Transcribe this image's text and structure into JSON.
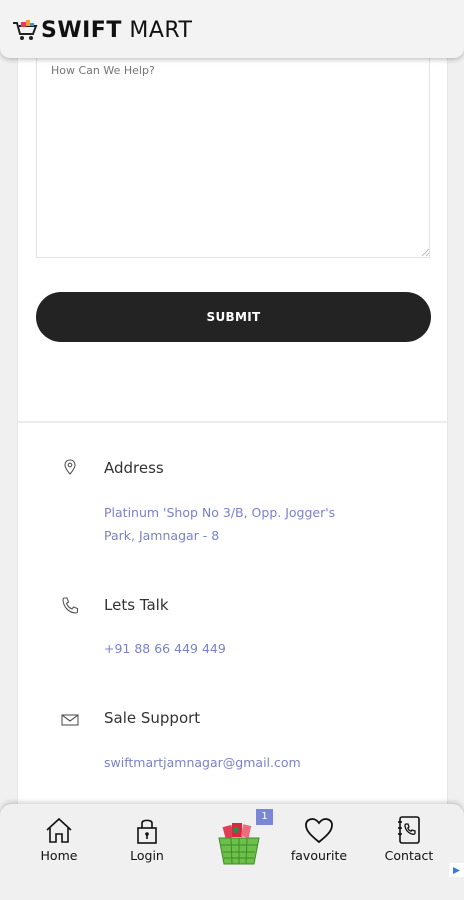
{
  "header": {
    "logo_bold": "SWIFT",
    "logo_regular": "MART"
  },
  "form": {
    "message_placeholder": "How Can We Help?",
    "submit_label": "SUBMIT"
  },
  "contact_info": {
    "address": {
      "title": "Address",
      "value_line1": "Platinum 'Shop No 3/B, Opp. Jogger's",
      "value_line2": "Park, Jamnagar - 8"
    },
    "talk": {
      "title": "Lets Talk",
      "value": "+91 88 66 449 449"
    },
    "support": {
      "title": "Sale Support",
      "value": "swiftmartjamnagar@gmail.com"
    }
  },
  "bottom_nav": {
    "home": "Home",
    "login": "Login",
    "cart_count": "1",
    "favourite": "favourite",
    "contact": "Contact"
  },
  "colors": {
    "accent": "#7b86d6",
    "link": "#7a82c9",
    "button": "#232323",
    "cart_green": "#6cc04a"
  }
}
